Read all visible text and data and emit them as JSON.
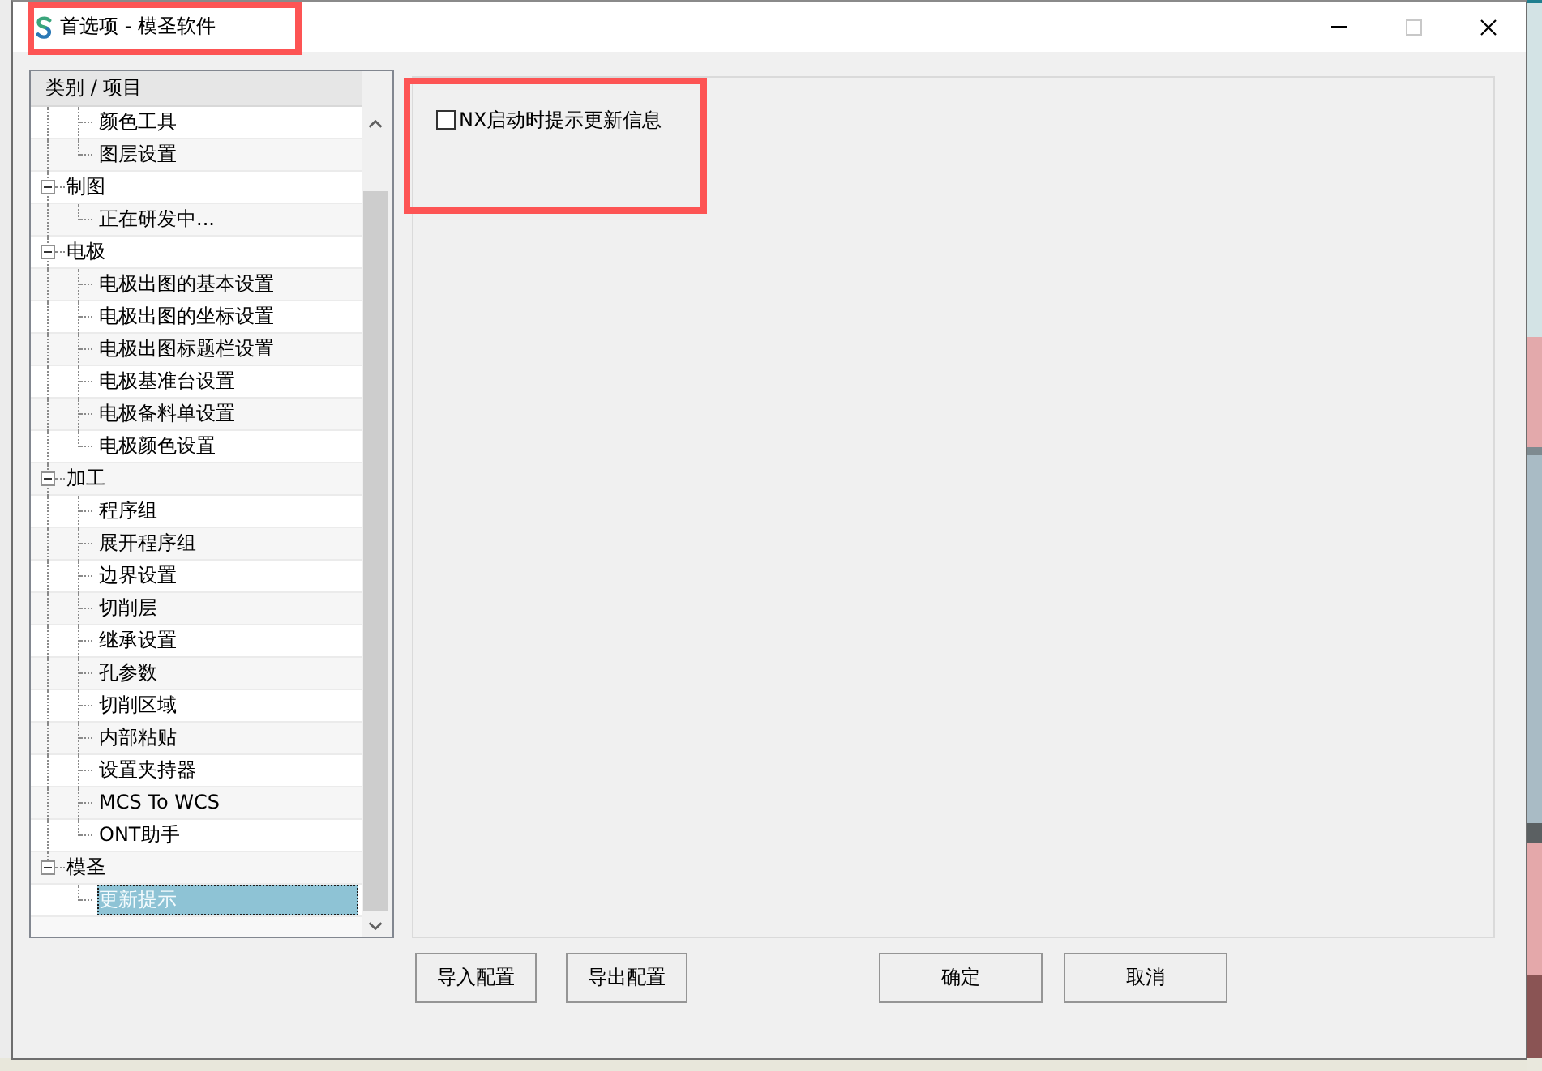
{
  "window": {
    "title": "首选项 - 模圣软件",
    "highlighted": true,
    "controls": [
      {
        "kind": "minimize",
        "disabled": false
      },
      {
        "kind": "maximize",
        "disabled": true
      },
      {
        "kind": "close",
        "disabled": false
      }
    ]
  },
  "tree": {
    "header": "类别 / 项目",
    "groups": [
      {
        "children": [
          {
            "label": "颜色工具",
            "selected": false
          },
          {
            "label": "图层设置",
            "selected": false
          }
        ]
      },
      {
        "label": "制图",
        "expanded": true,
        "selected": false,
        "children": [
          {
            "label": "正在研发中...",
            "selected": false
          }
        ]
      },
      {
        "label": "电极",
        "expanded": true,
        "selected": false,
        "children": [
          {
            "label": "电极出图的基本设置",
            "selected": false
          },
          {
            "label": "电极出图的坐标设置",
            "selected": false
          },
          {
            "label": "电极出图标题栏设置",
            "selected": false
          },
          {
            "label": "电极基准台设置",
            "selected": false
          },
          {
            "label": "电极备料单设置",
            "selected": false
          },
          {
            "label": "电极颜色设置",
            "selected": false
          }
        ]
      },
      {
        "label": "加工",
        "expanded": true,
        "selected": false,
        "children": [
          {
            "label": "程序组",
            "selected": false
          },
          {
            "label": "展开程序组",
            "selected": false
          },
          {
            "label": "边界设置",
            "selected": false
          },
          {
            "label": "切削层",
            "selected": false
          },
          {
            "label": "继承设置",
            "selected": false
          },
          {
            "label": "孔参数",
            "selected": false
          },
          {
            "label": "切削区域",
            "selected": false
          },
          {
            "label": "内部粘贴",
            "selected": false
          },
          {
            "label": "设置夹持器",
            "selected": false
          },
          {
            "label": "MCS To WCS",
            "selected": false
          },
          {
            "label": "ONT助手",
            "selected": false
          }
        ]
      },
      {
        "label": "模圣",
        "expanded": true,
        "selected": false,
        "children": [
          {
            "label": "更新提示",
            "selected": true
          }
        ]
      }
    ]
  },
  "settings": {
    "highlighted": true,
    "options": [
      {
        "label": "NX启动时提示更新信息",
        "checked": false
      }
    ]
  },
  "config_buttons": {
    "import": "导入配置",
    "export": "导出配置"
  },
  "dialog_buttons": {
    "ok": "确定",
    "cancel": "取消"
  }
}
